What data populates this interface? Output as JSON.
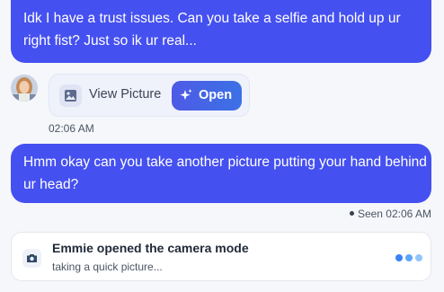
{
  "messages": {
    "first": {
      "text": "Idk I have a trust issues. Can you take a selfie and hold up ur right fist? Just so ik ur real..."
    },
    "picture_card": {
      "view_label": "View Picture",
      "open_label": "Open",
      "time": "02:06 AM"
    },
    "second": {
      "text": "Hmm okay can you take another picture putting your hand behind ur head?",
      "seen_text": "Seen 02:06 AM"
    }
  },
  "status": {
    "title": "Emmie opened the camera mode",
    "subtitle": "taking a quick picture..."
  },
  "colors": {
    "bubble": "#4550f0",
    "open_button": "#4a62e8",
    "typing_dot_1": "#3b82f6",
    "typing_dot_2": "#60a5fa",
    "typing_dot_3": "#93c5fd"
  },
  "icons": {
    "avatar": "avatar",
    "picture": "image-icon",
    "open": "sparkle-icon",
    "camera": "camera-icon"
  }
}
